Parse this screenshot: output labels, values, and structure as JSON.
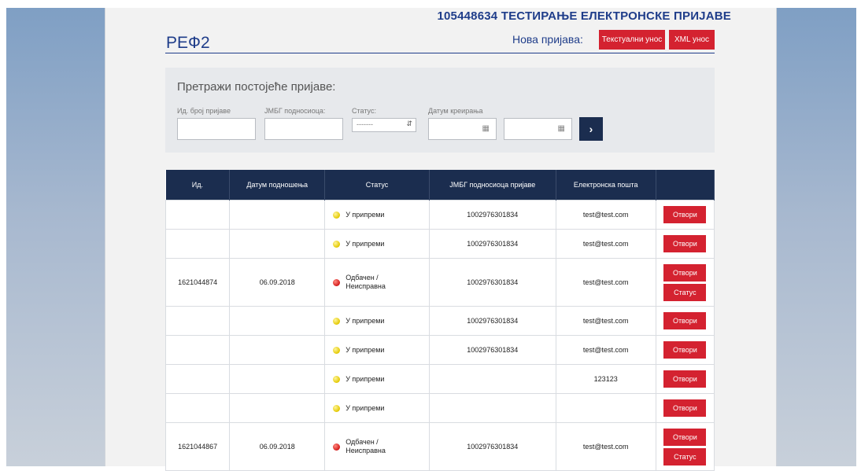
{
  "header": {
    "title": "105448634 ТЕСТИРАЊЕ ЕЛЕКТРОНСКЕ ПРИЈАВЕ",
    "ref": "РЕФ2",
    "new_label": "Нова пријава:",
    "text_entry_btn": "Текстуални унос",
    "xml_entry_btn": "XML унос"
  },
  "search": {
    "title": "Претражи постојеће пријаве:",
    "id_label": "Ид. број пријаве",
    "jmbg_label": "ЈМБГ подносиоца:",
    "status_label": "Статус:",
    "status_value": "-------",
    "date_label": "Датум креирања",
    "go_btn": "›"
  },
  "table": {
    "headers": [
      "Ид.",
      "Датум подношења",
      "Статус",
      "ЈМБГ подносиоца пријаве",
      "Електронска пошта",
      ""
    ],
    "open_btn": "Отвори",
    "status_btn": "Статус",
    "rows": [
      {
        "id": "",
        "date": "",
        "status": "У припреми",
        "status_color": "yellow",
        "jmbg": "1002976301834",
        "email": "test@test.com"
      },
      {
        "id": "",
        "date": "",
        "status": "У припреми",
        "status_color": "yellow",
        "jmbg": "1002976301834",
        "email": "test@test.com"
      },
      {
        "id": "1621044874",
        "date": "06.09.2018",
        "status": "Одбачен / Неисправна",
        "status_color": "red",
        "jmbg": "1002976301834",
        "email": "test@test.com"
      },
      {
        "id": "",
        "date": "",
        "status": "У припреми",
        "status_color": "yellow",
        "jmbg": "1002976301834",
        "email": "test@test.com"
      },
      {
        "id": "",
        "date": "",
        "status": "У припреми",
        "status_color": "yellow",
        "jmbg": "1002976301834",
        "email": "test@test.com"
      },
      {
        "id": "",
        "date": "",
        "status": "У припреми",
        "status_color": "yellow",
        "jmbg": "",
        "email": "123123"
      },
      {
        "id": "",
        "date": "",
        "status": "У припреми",
        "status_color": "yellow",
        "jmbg": "",
        "email": ""
      },
      {
        "id": "1621044867",
        "date": "06.09.2018",
        "status": "Одбачен / Неисправна",
        "status_color": "red",
        "jmbg": "1002976301834",
        "email": "test@test.com"
      }
    ]
  },
  "colors": {
    "navy": "#1b2d4f",
    "brand_blue": "#1f3d8a",
    "button_red": "#d42230"
  }
}
